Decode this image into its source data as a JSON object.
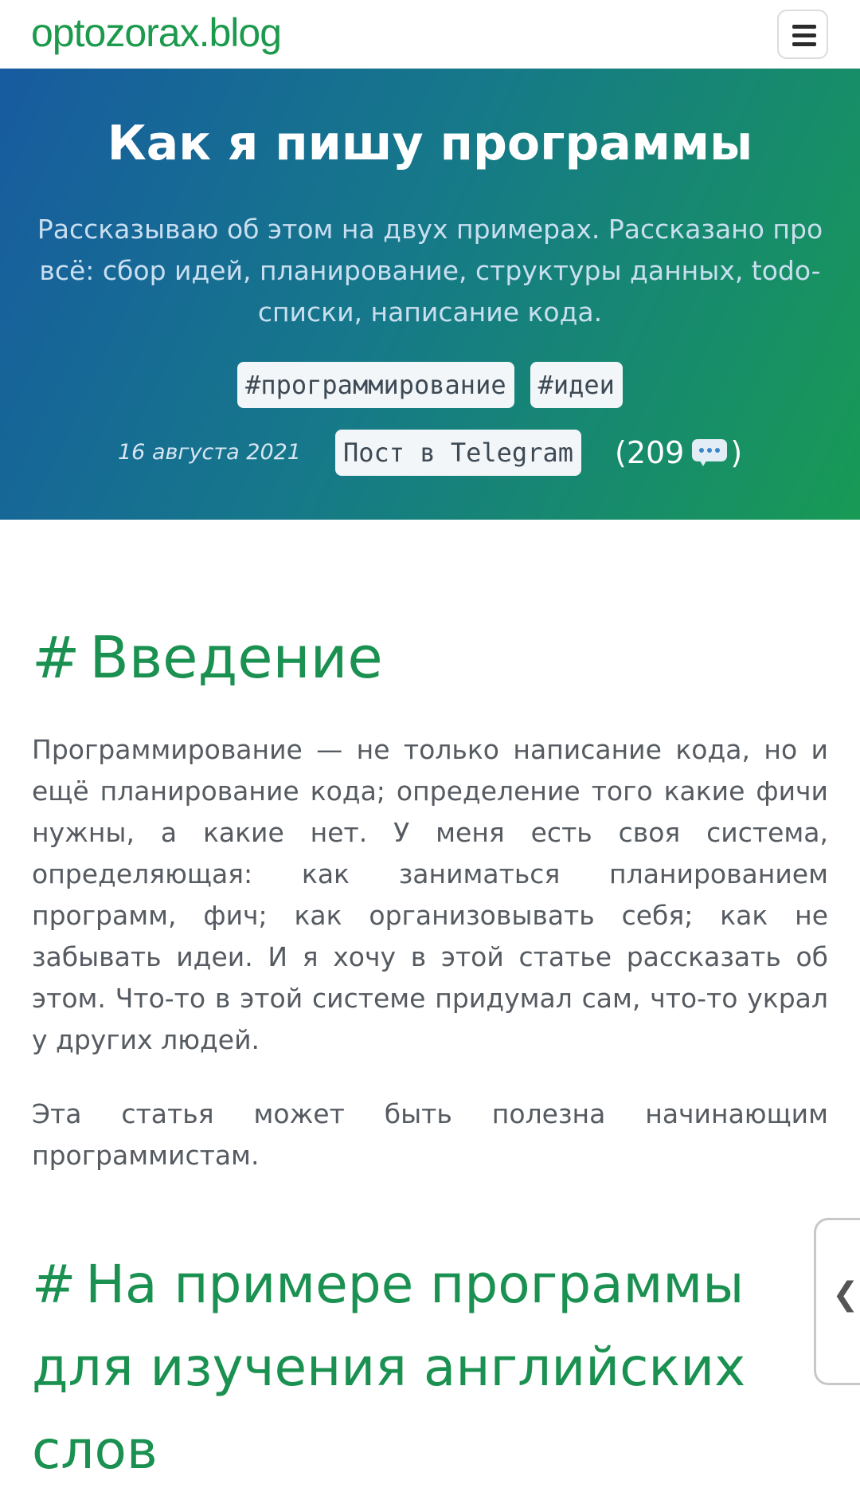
{
  "site": {
    "logo": "optozorax.blog"
  },
  "icons": {
    "menu": "hamburger-menu-icon",
    "comments": "speech-bubble-icon",
    "side_tab": "chevron-left-icon"
  },
  "colors": {
    "brand_green": "#1c9a4c",
    "heading_green": "#1a9150",
    "hero_gradient_start": "#175ba0",
    "hero_gradient_end": "#189a55"
  },
  "hero": {
    "title": "Как я пишу программы",
    "subtitle": "Рассказываю об этом на двух примерах. Рассказано про всё: сбор идей, планирование, структуры данных, todo-списки, написание кода.",
    "tags": [
      "#программирование",
      "#идеи"
    ],
    "date": "16 августа 2021",
    "telegram_label": "Пост в Telegram",
    "comments_open": "(209",
    "comments_close": ")"
  },
  "article": {
    "hash": "#",
    "sections": [
      {
        "heading": "Введение",
        "paragraphs": [
          "Программирование — не только написание кода, но и ещё планирование кода; определение того какие фичи нужны, а какие нет. У меня есть своя система, определяющая: как заниматься планированием программ, фич; как организовывать себя; как не забывать идеи. И я хочу в этой статье рассказать об этом. Что-то в этой системе придумал сам, что-то украл у других людей.",
          "Эта статья может быть полезна начинающим программистам."
        ]
      },
      {
        "heading": "На примере программы для изучения английских слов"
      }
    ]
  },
  "side_tab": {
    "glyph": "❮"
  }
}
